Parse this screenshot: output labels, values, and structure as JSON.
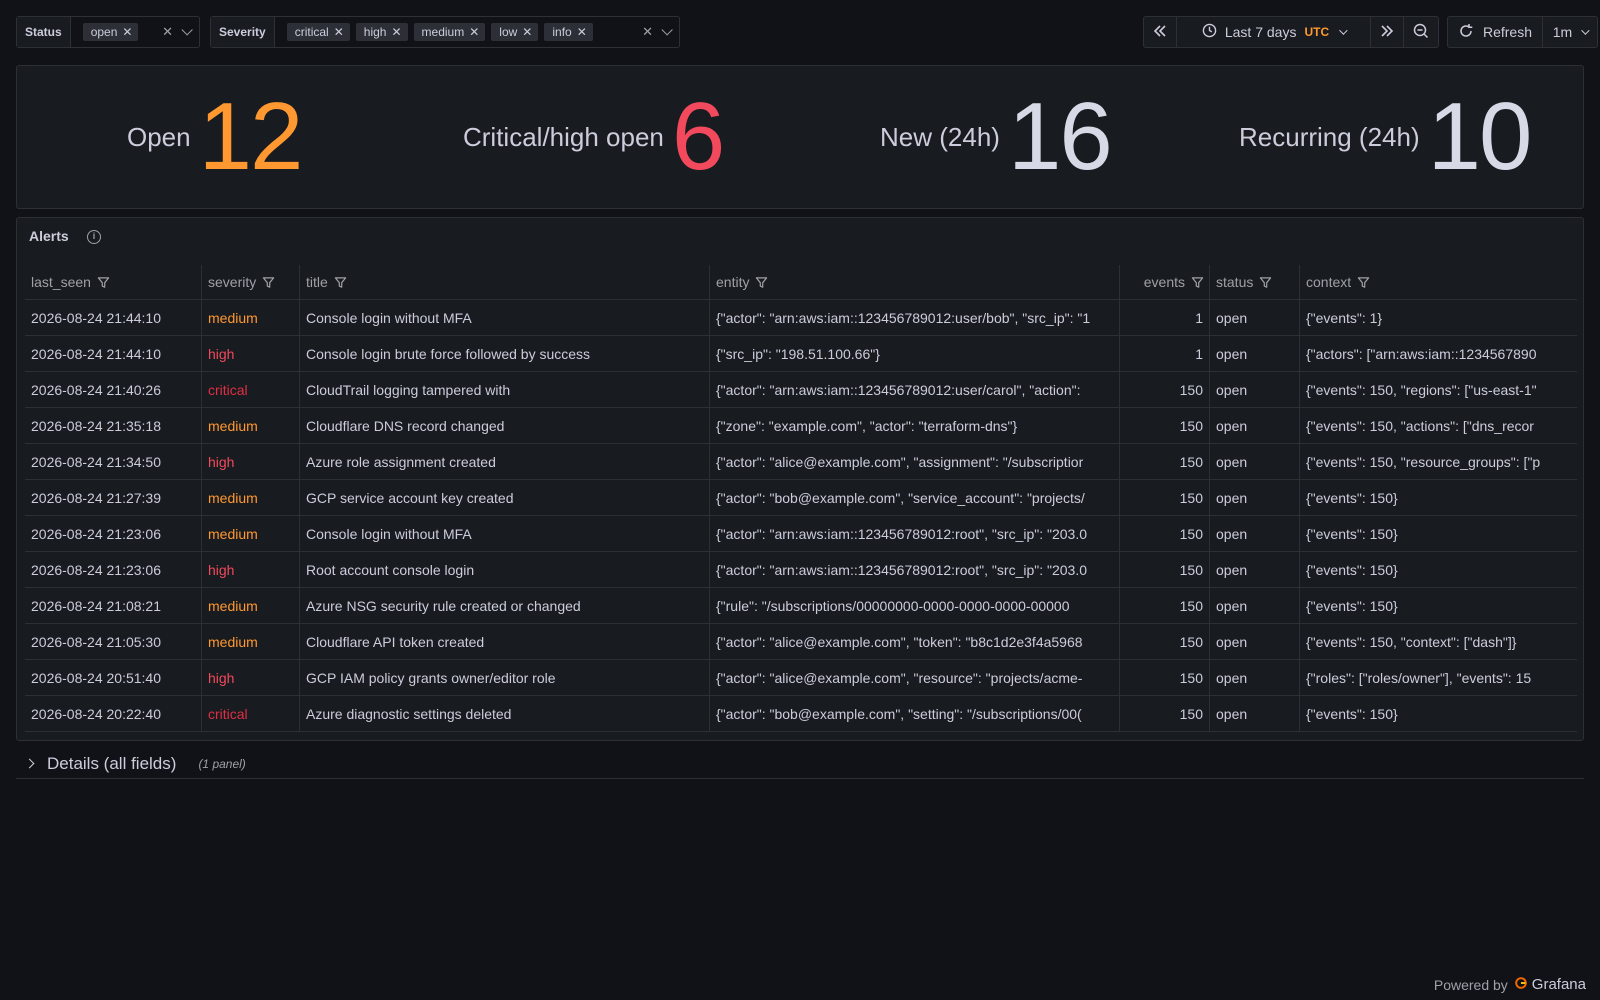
{
  "variables": {
    "status": {
      "label": "Status",
      "chips": [
        "open"
      ]
    },
    "severity": {
      "label": "Severity",
      "chips": [
        "critical",
        "high",
        "medium",
        "low",
        "info"
      ]
    }
  },
  "timepicker": {
    "range_label": "Last 7 days",
    "timezone": "UTC",
    "refresh_label": "Refresh",
    "refresh_interval": "1m"
  },
  "stats": [
    {
      "label": "Open",
      "value": "12",
      "color": "#ff9830"
    },
    {
      "label": "Critical/high open",
      "value": "6",
      "color": "#f2495c"
    },
    {
      "label": "New (24h)",
      "value": "16",
      "color": "#d8d9e6"
    },
    {
      "label": "Recurring (24h)",
      "value": "10",
      "color": "#d8d9e6"
    }
  ],
  "alerts": {
    "title": "Alerts",
    "columns": [
      "last_seen",
      "severity",
      "title",
      "entity",
      "events",
      "status",
      "context"
    ],
    "rows": [
      {
        "last_seen": "2026-08-24 21:44:10",
        "severity": "medium",
        "title": "Console login without MFA",
        "entity": "{\"actor\": \"arn:aws:iam::123456789012:user/bob\", \"src_ip\": \"1",
        "events": "1",
        "status": "open",
        "context": "{\"events\": 1}"
      },
      {
        "last_seen": "2026-08-24 21:44:10",
        "severity": "high",
        "title": "Console login brute force followed by success",
        "entity": "{\"src_ip\": \"198.51.100.66\"}",
        "events": "1",
        "status": "open",
        "context": "{\"actors\": [\"arn:aws:iam::1234567890"
      },
      {
        "last_seen": "2026-08-24 21:40:26",
        "severity": "critical",
        "title": "CloudTrail logging tampered with",
        "entity": "{\"actor\": \"arn:aws:iam::123456789012:user/carol\", \"action\": ",
        "events": "150",
        "status": "open",
        "context": "{\"events\": 150, \"regions\": [\"us-east-1\""
      },
      {
        "last_seen": "2026-08-24 21:35:18",
        "severity": "medium",
        "title": "Cloudflare DNS record changed",
        "entity": "{\"zone\": \"example.com\", \"actor\": \"terraform-dns\"}",
        "events": "150",
        "status": "open",
        "context": "{\"events\": 150, \"actions\": [\"dns_recor"
      },
      {
        "last_seen": "2026-08-24 21:34:50",
        "severity": "high",
        "title": "Azure role assignment created",
        "entity": "{\"actor\": \"alice@example.com\", \"assignment\": \"/subscriptior",
        "events": "150",
        "status": "open",
        "context": "{\"events\": 150, \"resource_groups\": [\"p"
      },
      {
        "last_seen": "2026-08-24 21:27:39",
        "severity": "medium",
        "title": "GCP service account key created",
        "entity": "{\"actor\": \"bob@example.com\", \"service_account\": \"projects/",
        "events": "150",
        "status": "open",
        "context": "{\"events\": 150}"
      },
      {
        "last_seen": "2026-08-24 21:23:06",
        "severity": "medium",
        "title": "Console login without MFA",
        "entity": "{\"actor\": \"arn:aws:iam::123456789012:root\", \"src_ip\": \"203.0",
        "events": "150",
        "status": "open",
        "context": "{\"events\": 150}"
      },
      {
        "last_seen": "2026-08-24 21:23:06",
        "severity": "high",
        "title": "Root account console login",
        "entity": "{\"actor\": \"arn:aws:iam::123456789012:root\", \"src_ip\": \"203.0",
        "events": "150",
        "status": "open",
        "context": "{\"events\": 150}"
      },
      {
        "last_seen": "2026-08-24 21:08:21",
        "severity": "medium",
        "title": "Azure NSG security rule created or changed",
        "entity": "{\"rule\": \"/subscriptions/00000000-0000-0000-0000-00000",
        "events": "150",
        "status": "open",
        "context": "{\"events\": 150}"
      },
      {
        "last_seen": "2026-08-24 21:05:30",
        "severity": "medium",
        "title": "Cloudflare API token created",
        "entity": "{\"actor\": \"alice@example.com\", \"token\": \"b8c1d2e3f4a5968",
        "events": "150",
        "status": "open",
        "context": "{\"events\": 150, \"context\": [\"dash\"]}"
      },
      {
        "last_seen": "2026-08-24 20:51:40",
        "severity": "high",
        "title": "GCP IAM policy grants owner/editor role",
        "entity": "{\"actor\": \"alice@example.com\", \"resource\": \"projects/acme-",
        "events": "150",
        "status": "open",
        "context": "{\"roles\": [\"roles/owner\"], \"events\": 15"
      },
      {
        "last_seen": "2026-08-24 20:22:40",
        "severity": "critical",
        "title": "Azure diagnostic settings deleted",
        "entity": "{\"actor\": \"bob@example.com\", \"setting\": \"/subscriptions/00(",
        "events": "150",
        "status": "open",
        "context": "{\"events\": 150}"
      }
    ]
  },
  "details_row": {
    "title": "Details (all fields)",
    "count": "(1 panel)"
  },
  "footer": {
    "powered_by": "Powered by",
    "brand": "Grafana"
  }
}
